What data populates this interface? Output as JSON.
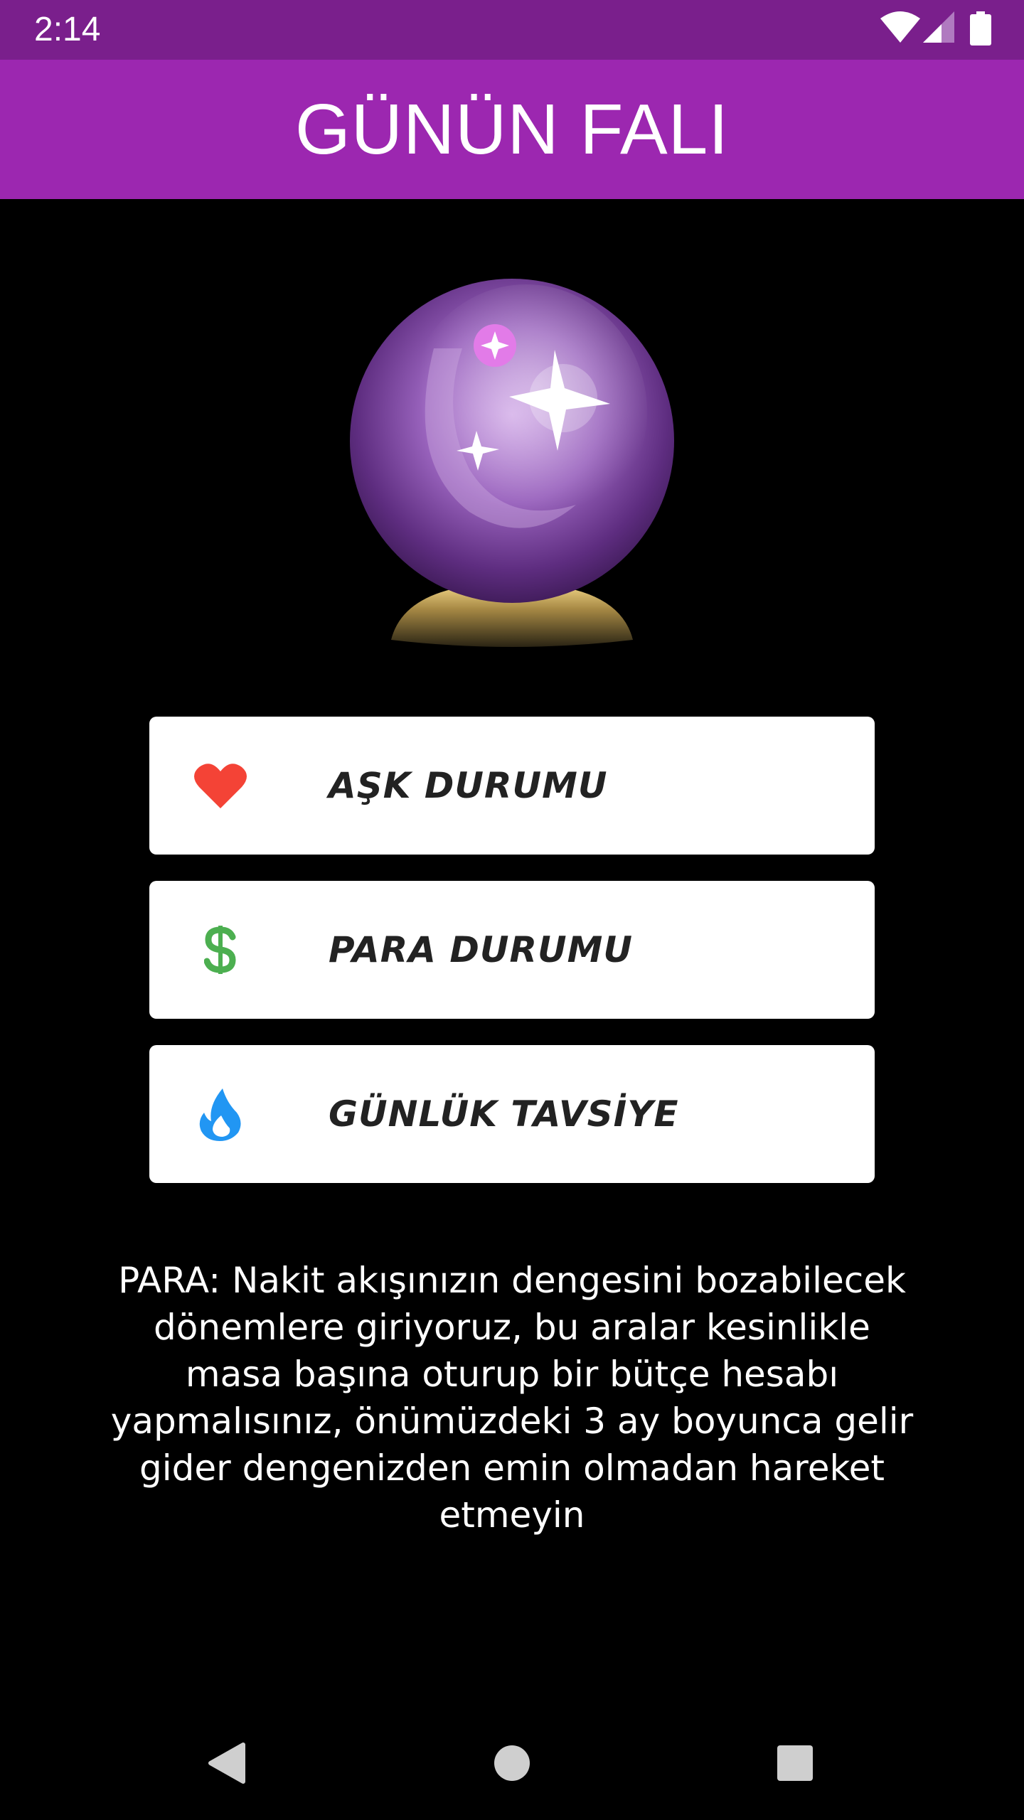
{
  "status_bar": {
    "time": "2:14",
    "icons": [
      "wifi-icon",
      "signal-icon",
      "battery-icon"
    ]
  },
  "app_bar": {
    "title": "GÜNÜN FALI",
    "color": "#9c27b0"
  },
  "menu": {
    "items": [
      {
        "label": "AŞK DURUMU",
        "icon": "heart-icon"
      },
      {
        "label": "PARA DURUMU",
        "icon": "dollar-icon"
      },
      {
        "label": "GÜNLÜK TAVSİYE",
        "icon": "flame-icon"
      }
    ]
  },
  "fortune": {
    "text": "PARA: Nakit akışınızın dengesini bozabilecek dönemlere giriyoruz, bu aralar kesinlikle masa başına oturup bir bütçe hesabı yapmalısınız, önümüzdeki 3 ay boyunca gelir gider dengenizden emin olmadan hareket etmeyin"
  },
  "nav_bar": {
    "buttons": [
      "back-icon",
      "home-icon",
      "recents-icon"
    ]
  }
}
